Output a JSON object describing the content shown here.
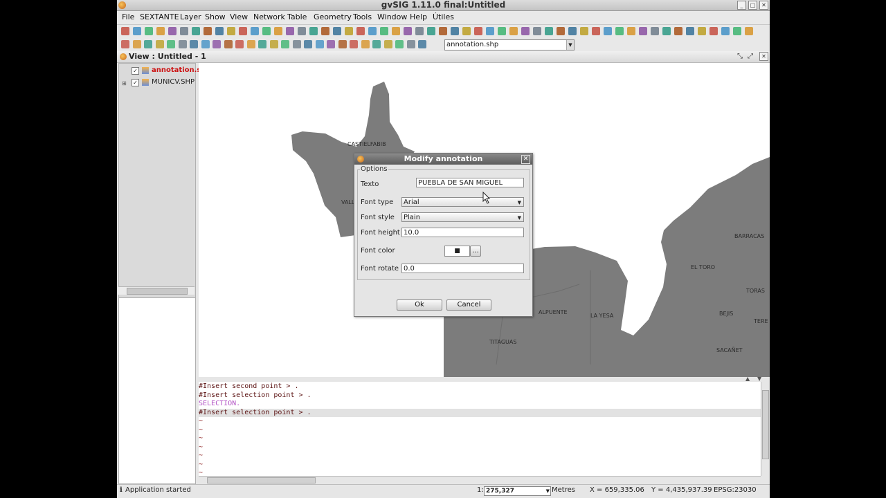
{
  "app": {
    "title": "gvSIG 1.11.0 final:Untitled"
  },
  "menu": [
    "File",
    "SEXTANTE",
    "Layer",
    "Show",
    "View",
    "Network",
    "Table",
    "Geometry",
    "Tools",
    "Window",
    "Help",
    "Útiles"
  ],
  "toolbar": {
    "layer_combo": "annotation.shp"
  },
  "view": {
    "title": "View : Untitled - 1"
  },
  "toc": {
    "layers": [
      {
        "name": "annotation.s",
        "active": true
      },
      {
        "name": "MUNICV.SHP",
        "active": false
      }
    ]
  },
  "map": {
    "towns": [
      "CASTIELFABIB",
      "VALL",
      "BARRACAS",
      "EL TORO",
      "TORAS",
      "ALPUENTE",
      "LA YESA",
      "BEJIS",
      "TERE",
      "TITAGUAS",
      "SACAÑET"
    ]
  },
  "dialog": {
    "title": "Modify annotation",
    "group": "Options",
    "fields": {
      "texto_label": "Texto",
      "texto_value": "PUEBLA DE SAN MIGUEL",
      "type_label": "Font type",
      "type_value": "Arial",
      "style_label": "Font style",
      "style_value": "Plain",
      "height_label": "Font height",
      "height_value": "10.0",
      "color_label": "Font color",
      "color_swatch": "■",
      "color_more": "...",
      "rotate_label": "Font rotate",
      "rotate_value": "0.0"
    },
    "ok": "Ok",
    "cancel": "Cancel"
  },
  "console": [
    {
      "text": "#Insert second point > .",
      "color": "#5a1010"
    },
    {
      "text": "#Insert selection point > .",
      "color": "#5a1010"
    },
    {
      "text": "SELECTION.",
      "color": "#b14fc4"
    },
    {
      "text": "#Insert selection point > .",
      "color": "#5a1010"
    },
    {
      "text": "~",
      "color": "#8a1a1a"
    },
    {
      "text": "~",
      "color": "#8a1a1a"
    },
    {
      "text": "~",
      "color": "#8a1a1a"
    },
    {
      "text": "~",
      "color": "#8a1a1a"
    },
    {
      "text": "~",
      "color": "#8a1a1a"
    },
    {
      "text": "~",
      "color": "#8a1a1a"
    },
    {
      "text": "~",
      "color": "#8a1a1a"
    }
  ],
  "status": {
    "message": "Application started",
    "scale_prefix": "1:",
    "scale": "275,327",
    "units": "Metres",
    "x": "X = 659,335.06",
    "y": "Y = 4,435,937.39",
    "epsg": "EPSG:23030"
  }
}
